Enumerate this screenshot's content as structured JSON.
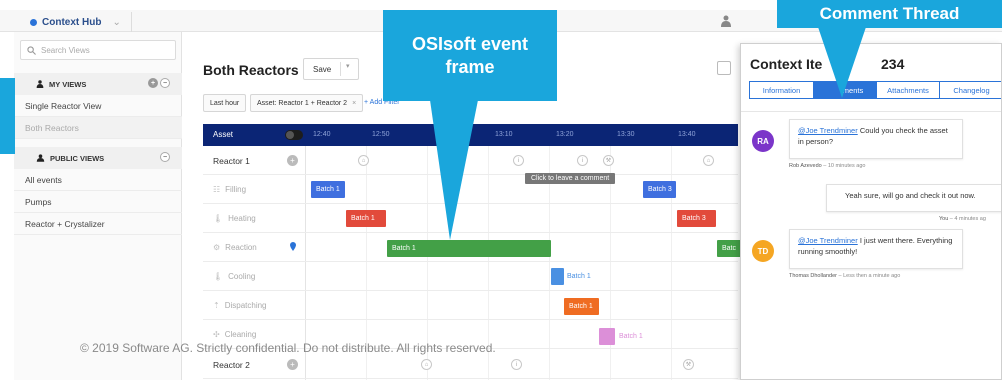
{
  "app": {
    "title": "Context Hub"
  },
  "sidebar": {
    "search_placeholder": "Search Views",
    "my_views": {
      "header": "MY VIEWS",
      "items": [
        "Single Reactor View",
        "Both Reactors"
      ]
    },
    "public_views": {
      "header": "PUBLIC VIEWS",
      "items": [
        "All events",
        "Pumps",
        "Reactor + Crystalizer"
      ]
    }
  },
  "main": {
    "title": "Both Reactors",
    "save_label": "Save",
    "filters": {
      "time": "Last hour",
      "asset": "Asset: Reactor 1 + Reactor 2",
      "add": "+ Add Filter"
    },
    "timeline": {
      "asset_header": "Asset",
      "times": [
        "12:40",
        "12:50",
        "13:10",
        "13:20",
        "13:30",
        "13:40"
      ],
      "rows": [
        {
          "name": "Reactor 1",
          "kind": "reactor"
        },
        {
          "name": "Filling",
          "icon": "filling-icon"
        },
        {
          "name": "Heating",
          "icon": "thermometer-icon"
        },
        {
          "name": "Reaction",
          "icon": "reaction-icon"
        },
        {
          "name": "Cooling",
          "icon": "thermometer-icon"
        },
        {
          "name": "Dispatching",
          "icon": "dispatch-icon"
        },
        {
          "name": "Cleaning",
          "icon": "cleaning-icon"
        },
        {
          "name": "Reactor 2",
          "kind": "reactor"
        }
      ],
      "batches": [
        {
          "label": "Batch 1",
          "color": "#3f6fdf"
        },
        {
          "label": "Batch 3",
          "color": "#3f6fdf"
        },
        {
          "label": "Batch 1",
          "color": "#e24a3b"
        },
        {
          "label": "Batch 3",
          "color": "#e24a3b"
        },
        {
          "label": "Batch 1",
          "color": "#43a047"
        },
        {
          "label": "Batch 1",
          "color": "#4a90e2"
        },
        {
          "label": "Batch 1",
          "color": "#ef6c22"
        },
        {
          "label": "Batch 1",
          "color": "#dc8fd8"
        }
      ],
      "truncated_batch_label": "Batc",
      "tooltip": "Click to leave a comment"
    }
  },
  "callouts": {
    "osisoft": "OSIsoft event frame",
    "comment_thread": "Comment Thread"
  },
  "panel": {
    "title_left": "Context Ite",
    "title_right": "234",
    "tabs": [
      "Information",
      "Comments",
      "Attachments",
      "Changelog"
    ],
    "tab_active_visible": "ments",
    "comments": [
      {
        "initials": "RA",
        "avatar_color": "#7b35c9",
        "mention": "@Joe Trendminer",
        "text": " Could you check the asset in person?",
        "author": "Rob Azevedo",
        "time": " – 10 minutes ago"
      },
      {
        "text": "Yeah sure, will go and check it out now.",
        "author": "You",
        "time": " – 4 minutes ag"
      },
      {
        "initials": "TD",
        "avatar_color": "#f5a623",
        "mention": "@Joe Trendminer",
        "text": " I just went there. Everything running smoothly!",
        "author": "Thomas Dhollander",
        "time": " – Less then a minute ago"
      }
    ]
  },
  "footer": {
    "copyright": "© 2019 Software AG. Strictly confidential. Do not distribute. All rights reserved."
  }
}
